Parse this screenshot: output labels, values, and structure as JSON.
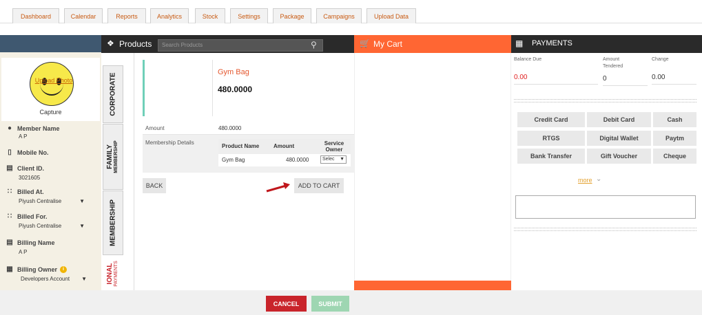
{
  "nav": {
    "tabs": [
      "Dashboard",
      "Calendar",
      "Reports",
      "Analytics",
      "Stock",
      "Settings",
      "Package",
      "Campaigns",
      "Upload Data"
    ]
  },
  "profile": {
    "upload_photo": "Upload Photo",
    "capture": "Capture"
  },
  "member": {
    "name_label": "Member Name",
    "name_value": "A P",
    "mobile_label": "Mobile No.",
    "client_label": "Client ID.",
    "client_value": "3021605",
    "billed_at_label": "Billed At.",
    "billed_at_value": "Piyush Centralise",
    "billed_for_label": "Billed For.",
    "billed_for_value": "Piyush Centralise",
    "billing_name_label": "Billing Name",
    "billing_name_value": "A P",
    "billing_owner_label": "Billing Owner",
    "billing_owner_value": "Developers Account",
    "caret": "▼"
  },
  "products": {
    "title": "Products",
    "search_placeholder": "Search Products",
    "vtabs": {
      "corporate": "CORPORATE",
      "family": "FAMILY",
      "family_sub": "MEMBERSHIP",
      "membership": "MEMBERSHIP",
      "optional": "IONAL",
      "optional_sub": "PAYMENTS"
    },
    "item_name": "Gym Bag",
    "item_price": "480.0000",
    "amount_label": "Amount",
    "amount_value": "480.0000",
    "details_label": "Membership Details",
    "table": {
      "headers": [
        "Product Name",
        "Amount",
        "Service Owner"
      ],
      "rows": [
        {
          "product": "Gym Bag",
          "amount": "480.0000",
          "owner": "Selec"
        }
      ]
    },
    "back_label": "BACK",
    "add_label": "ADD TO CART"
  },
  "cart": {
    "title": "My Cart"
  },
  "payments": {
    "title": "PAYMENTS",
    "balance_label": "Balance Due",
    "balance_value": "0.00",
    "tendered_label_1": "Amount",
    "tendered_label_2": "Tendered",
    "tendered_value": "0",
    "change_label": "Change",
    "change_value": "0.00",
    "methods": [
      "Credit Card",
      "Debit Card",
      "Cash",
      "RTGS",
      "Digital Wallet",
      "Paytm",
      "Bank Transfer",
      "Gift Voucher",
      "Cheque"
    ],
    "more": "more"
  },
  "footer": {
    "cancel": "CANCEL",
    "submit": "SUBMIT"
  },
  "colors": {
    "accent": "#ff6633",
    "dark_header": "#2a2a2a",
    "nav_text": "#c85a12",
    "cancel": "#c9242b",
    "submit": "#9ed6b2"
  }
}
